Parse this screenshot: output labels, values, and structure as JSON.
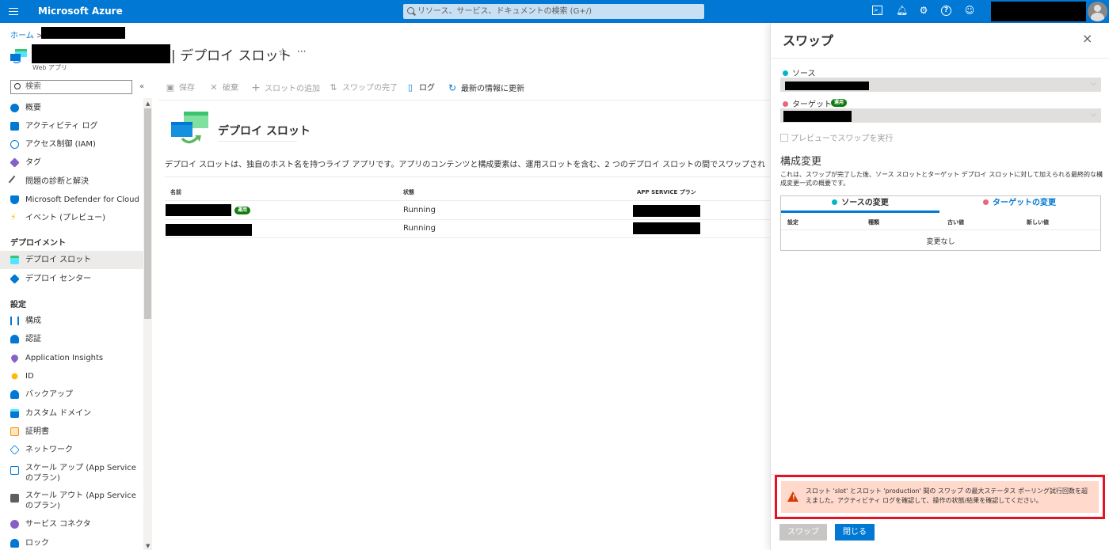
{
  "topbar": {
    "brand": "Microsoft Azure",
    "search_placeholder": "リソース、サービス、ドキュメントの検索 (G+/)",
    "accent": "#0078d4"
  },
  "breadcrumb": {
    "home": "ホーム",
    "separator": ">"
  },
  "page": {
    "title": "| デプロイ スロット",
    "subtitle": "Web アプリ",
    "favorite_icon": "star-icon",
    "more": "···"
  },
  "sidebar": {
    "search_placeholder": "検索",
    "collapse": "«",
    "items": [
      {
        "label": "概要",
        "icon": "overview-icon",
        "color": "#0078d4"
      },
      {
        "label": "アクティビティ ログ",
        "icon": "activity-log-icon",
        "color": "#0078d4"
      },
      {
        "label": "アクセス制御 (IAM)",
        "icon": "iam-icon",
        "color": "#0078d4"
      },
      {
        "label": "タグ",
        "icon": "tag-icon",
        "color": "#8661c5"
      },
      {
        "label": "問題の診断と解決",
        "icon": "wrench-icon",
        "color": "#605e5c"
      },
      {
        "label": "Microsoft Defender for Cloud",
        "icon": "shield-icon",
        "color": "#0078d4"
      },
      {
        "label": "イベント (プレビュー)",
        "icon": "lightning-icon",
        "color": "#ffb900"
      }
    ],
    "section_deploy": "デプロイメント",
    "deploy_items": [
      {
        "label": "デプロイ スロット",
        "icon": "deployment-slots-icon",
        "color": "#50e6ff"
      },
      {
        "label": "デプロイ センター",
        "icon": "deployment-center-icon",
        "color": "#0078d4"
      }
    ],
    "section_settings": "設定",
    "settings_items": [
      {
        "label": "構成",
        "icon": "configuration-icon",
        "color": "#0078d4"
      },
      {
        "label": "認証",
        "icon": "authentication-icon",
        "color": "#0078d4"
      },
      {
        "label": "Application Insights",
        "icon": "app-insights-icon",
        "color": "#8661c5"
      },
      {
        "label": "ID",
        "icon": "identity-icon",
        "color": "#ffb900"
      },
      {
        "label": "バックアップ",
        "icon": "backup-icon",
        "color": "#0078d4"
      },
      {
        "label": "カスタム ドメイン",
        "icon": "custom-domain-icon",
        "color": "#0078d4"
      },
      {
        "label": "証明書",
        "icon": "certificate-icon",
        "color": "#ff8c00"
      },
      {
        "label": "ネットワーク",
        "icon": "network-icon",
        "color": "#0078d4"
      },
      {
        "label": "スケール アップ (App Service のプラン)",
        "icon": "scale-up-icon",
        "color": "#0078d4"
      },
      {
        "label": "スケール アウト (App Service のプラン)",
        "icon": "scale-out-icon",
        "color": "#605e5c"
      },
      {
        "label": "サービス コネクタ",
        "icon": "service-connector-icon",
        "color": "#8661c5"
      },
      {
        "label": "ロック",
        "icon": "lock-icon",
        "color": "#0078d4"
      }
    ]
  },
  "toolbar": {
    "save": "保存",
    "discard": "破棄",
    "add_slot": "スロットの追加",
    "complete_swap": "スワップの完了",
    "log": "ログ",
    "refresh": "最新の情報に更新"
  },
  "main": {
    "hero_title": "デプロイ スロット",
    "description": "デプロイ スロットは、独自のホスト名を持つライブ アプリです。アプリのコンテンツと構成要素は、運用スロットを含む、2 つのデプロイ スロットの間でスワップされ",
    "columns": [
      "名前",
      "状態",
      "APP SERVICE プラン"
    ],
    "rows": [
      {
        "status": "Running",
        "badge": "運用"
      },
      {
        "status": "Running"
      }
    ]
  },
  "swap_panel": {
    "title": "スワップ",
    "close": "×",
    "source_label": "ソース",
    "target_label": "ターゲット",
    "target_badge": "運用",
    "source_color": "#00b7c3",
    "target_color": "#e8677a",
    "chevron": "⌵",
    "preview_checkbox": "プレビューでスワップを実行",
    "config_heading": "構成変更",
    "config_desc": "これは、スワップが完了した後、ソース スロットとターゲット デプロイ スロットに対して加えられる最終的な構成変更一式の概要です。",
    "tabs": [
      "ソースの変更",
      "ターゲットの変更"
    ],
    "columns": [
      "設定",
      "種類",
      "古い値",
      "新しい値"
    ],
    "no_change": "変更なし",
    "alert_text": "スロット 'slot' とスロット 'production' 間の スワップ の最大ステータス ポーリング試行回数を超えました。アクティビティ ログを確認して、操作の状態/結果を確認してください。",
    "alert_color": "#fed9cc",
    "swap_button": "スワップ",
    "close_button": "閉じる"
  }
}
